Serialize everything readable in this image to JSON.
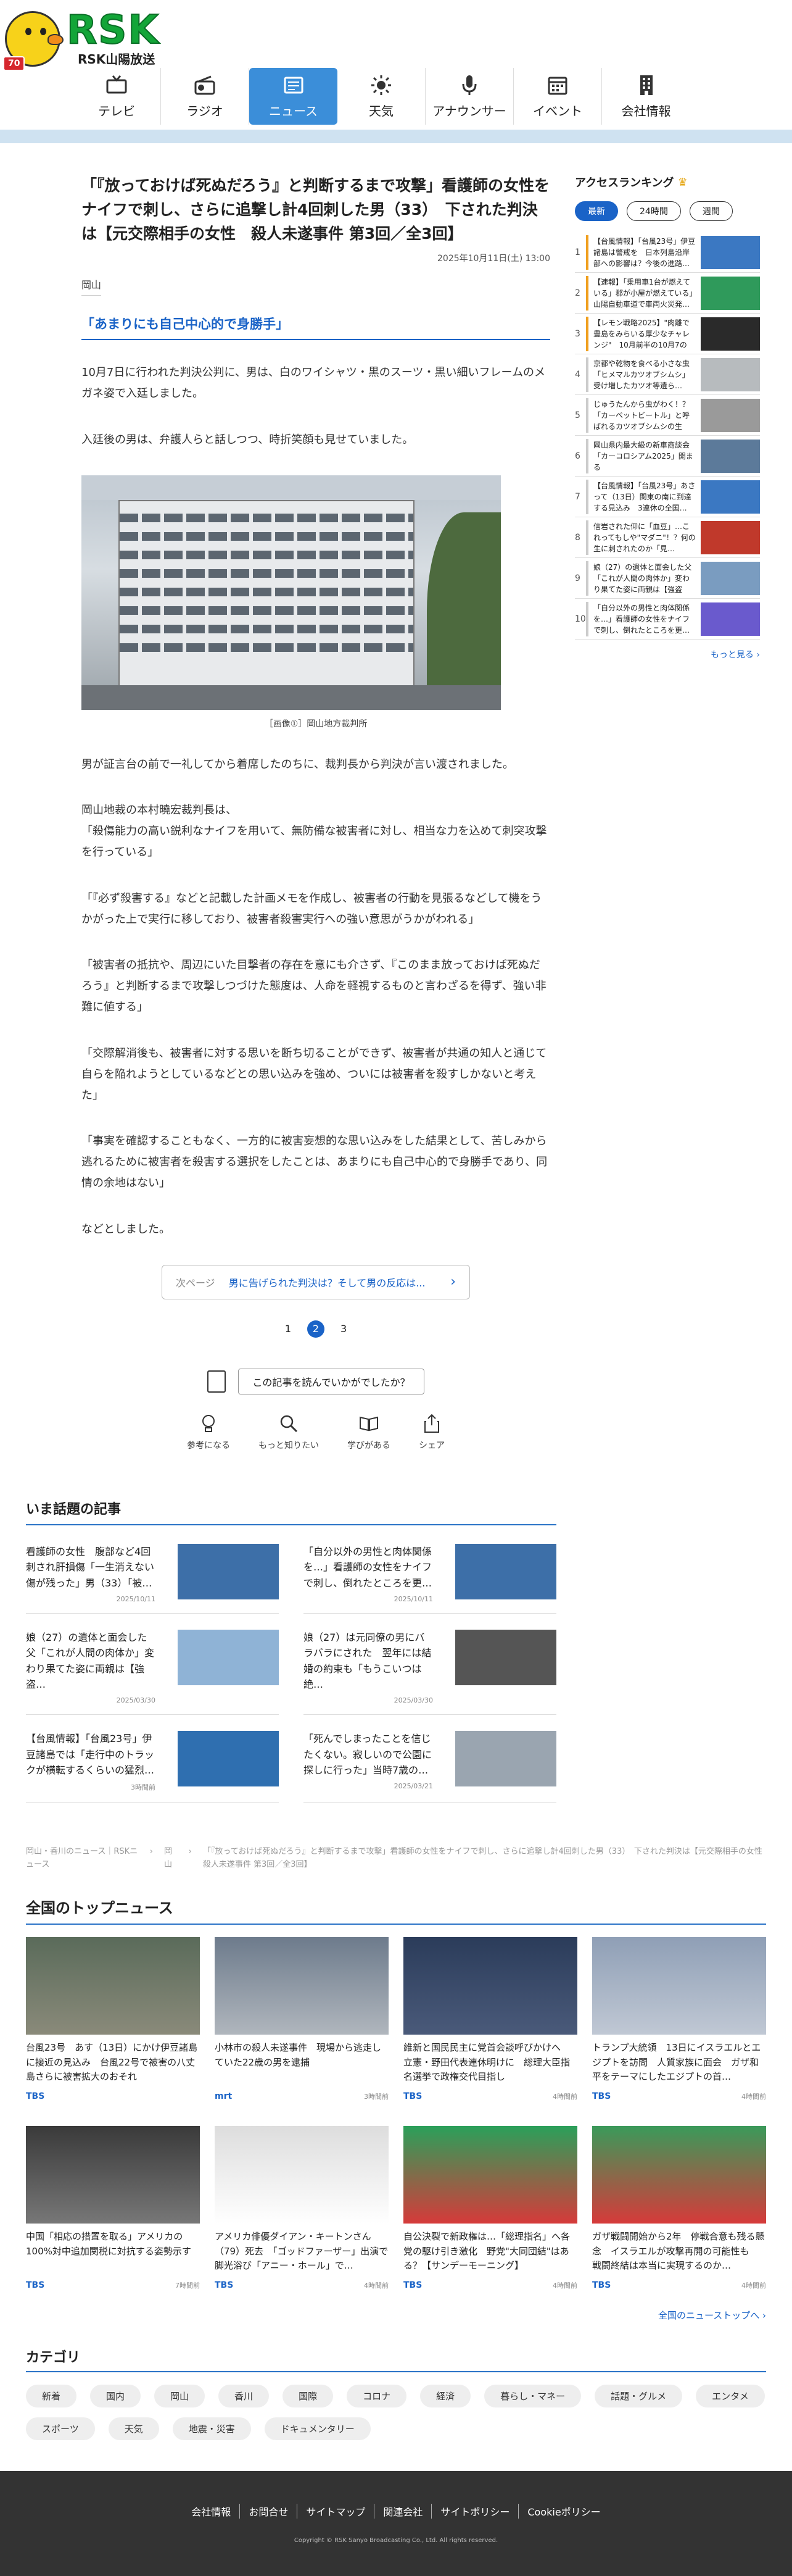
{
  "header": {
    "logo": "RSK",
    "logo_sub": "RSK山陽放送",
    "mascot_badge": "70",
    "nav": [
      {
        "label": "テレビ",
        "icon": "tv-icon"
      },
      {
        "label": "ラジオ",
        "icon": "radio-icon"
      },
      {
        "label": "ニュース",
        "icon": "news-icon",
        "active": true
      },
      {
        "label": "天気",
        "icon": "sun-icon"
      },
      {
        "label": "アナウンサー",
        "icon": "microphone-icon"
      },
      {
        "label": "イベント",
        "icon": "calendar-icon"
      },
      {
        "label": "会社情報",
        "icon": "building-icon"
      }
    ]
  },
  "article": {
    "title": "「『放っておけば死ぬだろう』と判断するまで攻撃」看護師の女性をナイフで刺し、さらに追撃し計4回刺した男（33）　下された判決は【元交際相手の女性　殺人未遂事件 第3回／全3回】",
    "date": "2025年10月11日(土) 13:00",
    "region": "岡山",
    "subhead": "「あまりにも自己中心的で身勝手」",
    "p1": "10月7日に行われた判決公判に、男は、白のワイシャツ・黒のスーツ・黒い細いフレームのメガネ姿で入廷しました。",
    "p2": "入廷後の男は、弁護人らと話しつつ、時折笑顔も見せていました。",
    "caption": "［画像①］岡山地方裁判所",
    "p3": "男が証言台の前で一礼してから着席したのちに、裁判長から判決が言い渡されました。",
    "p4": "岡山地裁の本村曉宏裁判長は、\n「殺傷能力の高い鋭利なナイフを用いて、無防備な被害者に対し、相当な力を込めて刺突攻撃を行っている」",
    "p5": "「『必ず殺害する』などと記載した計画メモを作成し、被害者の行動を見張るなどして機をうかがった上で実行に移しており、被害者殺害実行への強い意思がうかがわれる」",
    "p6": "「被害者の抵抗や、周辺にいた目撃者の存在を意にも介さず、『このまま放っておけば死ぬだろう』と判断するまで攻撃しつづけた態度は、人命を軽視するものと言わざるを得ず、強い非難に値する」",
    "p7": "「交際解消後も、被害者に対する思いを断ち切ることができず、被害者が共通の知人と通じて自らを陥れようとしているなどとの思い込みを強め、ついには被害者を殺すしかないと考えた」",
    "p8": "「事実を確認することもなく、一方的に被害妄想的な思い込みをした結果として、苦しみから逃れるために被害者を殺害する選択をしたことは、あまりにも自己中心的で身勝手であり、同情の余地はない」",
    "p9": "などとしました。",
    "next_label": "次ページ",
    "next_text": "男に告げられた判決は？そして男の反応は...",
    "pages": [
      "1",
      "2",
      "3"
    ],
    "feedback_q": "この記事を読んでいかがでしたか？",
    "reactions": [
      {
        "label": "参考になる",
        "icon": "lightbulb-icon"
      },
      {
        "label": "もっと知りたい",
        "icon": "magnifier-icon"
      },
      {
        "label": "学びがある",
        "icon": "book-icon"
      },
      {
        "label": "シェア",
        "icon": "share-icon"
      }
    ]
  },
  "topics": {
    "heading": "いま話題の記事",
    "items": [
      {
        "title": "看護師の女性　腹部など4回刺され肝損傷「一生消えない傷が残った」男（33）「被…",
        "time": "2025/10/11"
      },
      {
        "title": "「自分以外の男性と肉体関係を…」看護師の女性をナイフで刺し、倒れたところを更…",
        "time": "2025/10/11"
      },
      {
        "title": "娘（27）の遺体と面会した父「これが人間の肉体か」変わり果てた姿に両親は【強盗…",
        "time": "2025/03/30"
      },
      {
        "title": "娘（27）は元同僚の男にバラバラにされた　翌年には結婚の約束も「もうこいつは絶…",
        "time": "2025/03/30"
      },
      {
        "title": "【台風情報】「台風23号」伊豆諸島では「走行中のトラックが横転するくらいの猛烈…",
        "time": "3時間前"
      },
      {
        "title": "「死んでしまったことを信じたくない。寂しいので公園に探しに行った」当時7歳の…",
        "time": "2025/03/21"
      }
    ]
  },
  "breadcrumb": [
    "岡山・香川のニュース｜RSKニュース",
    "岡山",
    "「『放っておけば死ぬだろう』と判断するまで攻撃」看護師の女性をナイフで刺し、さらに追撃し計4回刺した男（33）　下された判決は【元交際相手の女性　殺人未遂事件 第3回／全3回】"
  ],
  "national": {
    "heading": "全国のトップニュース",
    "more": "全国のニューストップへ ›",
    "items": [
      {
        "title": "台風23号　あす（13日）にかけ伊豆諸島に接近の見込み　台風22号で被害の八丈島さらに被害拡大のおそれ",
        "src": "TBS",
        "time": ""
      },
      {
        "title": "小林市の殺人未遂事件　現場から逃走していた22歳の男を逮捕",
        "src": "mrt",
        "time": "3時間前"
      },
      {
        "title": "維新と国民民主に党首会談呼びかけへ　立憲・野田代表連休明けに　総理大臣指名選挙で政権交代目指し",
        "src": "TBS",
        "time": "4時間前"
      },
      {
        "title": "トランプ大統領　13日にイスラエルとエジプトを訪問　人質家族に面会　ガザ和平をテーマにしたエジプトの首…",
        "src": "TBS",
        "time": "4時間前"
      },
      {
        "title": "中国「相応の措置を取る」アメリカの100%対中追加関税に対抗する姿勢示す",
        "src": "TBS",
        "time": "7時間前"
      },
      {
        "title": "アメリカ俳優ダイアン・キートンさん（79）死去　「ゴッドファーザー」出演で脚光浴び「アニー・ホール」で…",
        "src": "TBS",
        "time": "4時間前"
      },
      {
        "title": "自公決裂で新政権は…「総理指名」へ各党の駆け引き激化　野党\"大同団結\"はある？【サンデーモーニング】",
        "src": "TBS",
        "time": "4時間前"
      },
      {
        "title": "ガザ戦闘開始から2年　停戦合意も残る懸念　イスラエルが攻撃再開の可能性も　戦闘終結は本当に実現するのか…",
        "src": "TBS",
        "time": "4時間前"
      }
    ]
  },
  "categories": {
    "heading": "カテゴリ",
    "items": [
      "新着",
      "国内",
      "岡山",
      "香川",
      "国際",
      "コロナ",
      "経済",
      "暮らし・マネー",
      "話題・グルメ",
      "エンタメ",
      "スポーツ",
      "天気",
      "地震・災害",
      "ドキュメンタリー"
    ]
  },
  "ranking": {
    "heading": "アクセスランキング",
    "tabs": [
      "最新",
      "24時間",
      "週間"
    ],
    "more": "もっと見る ›",
    "items": [
      {
        "n": "1",
        "title": "【台風情報】「台風23号」伊豆諸島は警戒を　日本列島沿岸部への影響は？今後の進路…",
        "color": "#f0a020"
      },
      {
        "n": "2",
        "title": "【速報】「乗用車1台が燃えている」郡が小屋が燃えている」山陽自動車道で車両火災発…",
        "color": "#f0a020"
      },
      {
        "n": "3",
        "title": "【レモン戦略2025】\"肉離で豊島をみらいる厚少なチャレンジ\"　10月前半の10月7の事…",
        "color": "#f0a020"
      },
      {
        "n": "4",
        "title": "京都や乾物を食べる小さな虫「ヒメマルカツオブシムシ」受け増したカツオ等遺ら…",
        "color": "#ccc"
      },
      {
        "n": "5",
        "title": "じゅうたんから虫がわく！？「カーペットビートル」と呼ばれるカツオブシムシの生態…",
        "color": "#ccc"
      },
      {
        "n": "6",
        "title": "岡山県内最大級の新車商談会「カーコロシアム2025」開まる",
        "color": "#ccc"
      },
      {
        "n": "7",
        "title": "【台風情報】「台風23号」あさって（13日）関東の南に到達する見込み　3連休の全国…",
        "color": "#ccc"
      },
      {
        "n": "8",
        "title": "信岩された仰に「血豆」…これってもしや\"マダニ\"！？何の生に刺されたのか「見…",
        "color": "#ccc"
      },
      {
        "n": "9",
        "title": "娘（27）の遺体と面会した父「これが人間の肉体か」変わり果てた姿に両親は【強盗殺…",
        "color": "#ccc"
      },
      {
        "n": "10",
        "title": "「自分以外の男性と肉体関係を…」看護師の女性をナイフで刺し、倒れたところを更…",
        "color": "#ccc"
      }
    ]
  },
  "footer": {
    "links": [
      "会社情報",
      "お問合せ",
      "サイトマップ",
      "関連会社",
      "サイトポリシー",
      "Cookieポリシー"
    ],
    "copy": "Copyright © RSK Sanyo Broadcasting Co., Ltd. All rights reserved."
  }
}
